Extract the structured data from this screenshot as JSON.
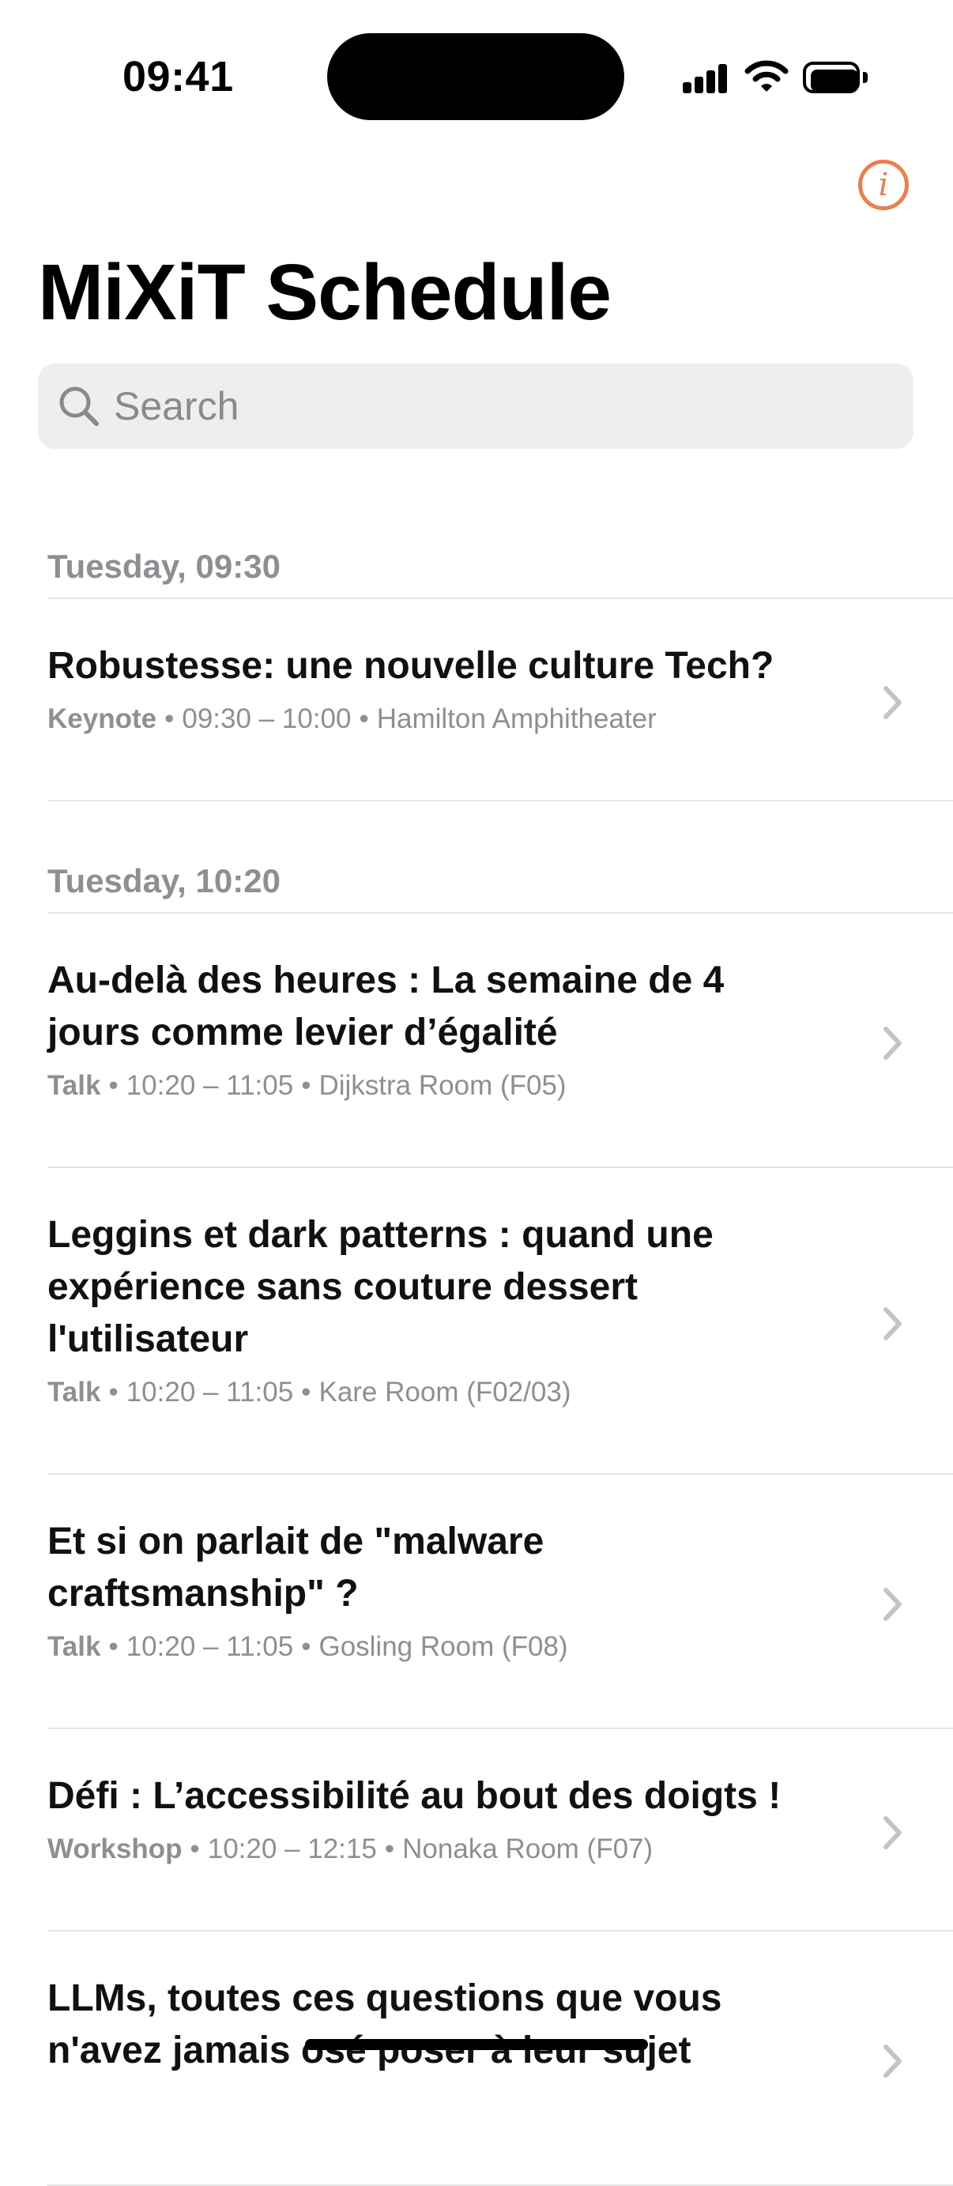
{
  "status_bar": {
    "time": "09:41"
  },
  "header": {
    "title": "MiXiT Schedule",
    "info_icon": "info-circle-icon",
    "accent_color": "#E8804F"
  },
  "search": {
    "placeholder": "Search",
    "icon": "magnifying-glass-icon"
  },
  "sections": [
    {
      "header": "Tuesday, 09:30",
      "sessions": [
        {
          "title_lines": [
            "Robustesse: une nouvelle culture Tech?"
          ],
          "kind": "Keynote",
          "time": "09:30 – 10:00",
          "room": "Hamilton Amphitheater"
        }
      ]
    },
    {
      "header": "Tuesday, 10:20",
      "sessions": [
        {
          "title_lines": [
            "Au-delà des heures : La semaine de 4",
            "jours comme levier d’égalité"
          ],
          "kind": "Talk",
          "time": "10:20 – 11:05",
          "room": "Dijkstra Room (F05)"
        },
        {
          "title_lines": [
            "Leggins et dark patterns : quand une",
            "expérience sans couture dessert",
            "l'utilisateur"
          ],
          "kind": "Talk",
          "time": "10:20 – 11:05",
          "room": "Kare Room (F02/03)"
        },
        {
          "title_lines": [
            "Et si on parlait de \"malware",
            "craftsmanship\" ?"
          ],
          "kind": "Talk",
          "time": "10:20 – 11:05",
          "room": "Gosling Room (F08)"
        },
        {
          "title_lines": [
            "Défi : L’accessibilité au bout des doigts !"
          ],
          "kind": "Workshop",
          "time": "10:20 – 12:15",
          "room": "Nonaka Room (F07)"
        },
        {
          "title_lines": [
            "LLMs, toutes ces questions que vous",
            "n'avez jamais osé poser à leur sujet"
          ],
          "kind": "",
          "time": "",
          "room": ""
        }
      ]
    }
  ]
}
